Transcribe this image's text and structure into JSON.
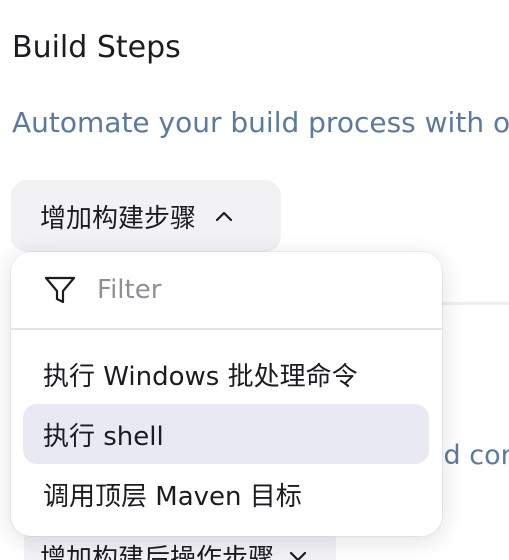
{
  "section": {
    "title": "Build Steps",
    "description": "Automate your build process with ordered tasks"
  },
  "add_step_button": {
    "label": "增加构建步骤"
  },
  "dropdown": {
    "filter_placeholder": "Filter",
    "items": [
      {
        "label": "执行 Windows 批处理命令",
        "active": false
      },
      {
        "label": "执行 shell",
        "active": true
      },
      {
        "label": "调用顶层 Maven 目标",
        "active": false
      }
    ]
  },
  "background": {
    "card_text_fragment": "ld con"
  },
  "post_build_button": {
    "label": "增加构建后操作步骤"
  },
  "colors": {
    "title": "#1b1b22",
    "description": "#5b7a9e",
    "button_bg": "#f2f2f5",
    "active_item_bg": "#e8e9f3"
  },
  "icons": {
    "add_step_chevron": "chevron-up-icon",
    "filter": "filter-funnel-icon",
    "post_build_chevron": "chevron-down-icon"
  }
}
